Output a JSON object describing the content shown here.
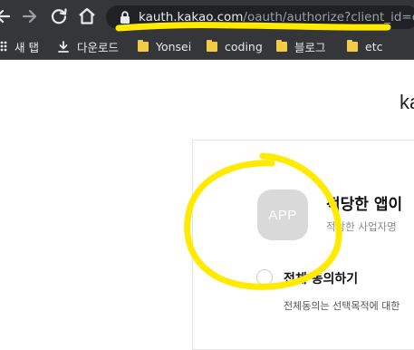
{
  "browser": {
    "url_host": "kauth.kakao.com",
    "url_path": "/oauth/authorize?client_id=eee",
    "bookmarks": [
      {
        "label": "새 탭",
        "icon": "apps-grid-icon"
      },
      {
        "label": "다운로드",
        "icon": "download-icon"
      },
      {
        "label": "Yonsei",
        "icon": "folder-icon"
      },
      {
        "label": "coding",
        "icon": "folder-icon"
      },
      {
        "label": "블로그",
        "icon": "folder-icon"
      },
      {
        "label": "etc",
        "icon": "folder-icon"
      }
    ]
  },
  "page": {
    "logo_text": "ka",
    "app_icon_text": "APP",
    "title": "적당한 앱이",
    "subtitle": "적당한 사업자명",
    "agree_all": "전체 동의하기",
    "agree_desc": "전체동의는 선택목적에 대한"
  },
  "colors": {
    "annotation": "#ffea00",
    "toolbar": "#35363a"
  }
}
